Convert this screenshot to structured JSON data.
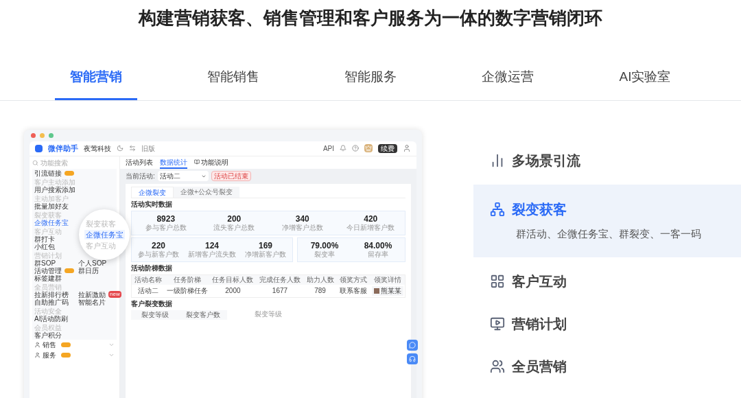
{
  "headline": "构建营销获客、销售管理和客户服务为一体的数字营销闭环",
  "tabs": [
    {
      "label": "智能营销",
      "selected": true
    },
    {
      "label": "智能销售",
      "selected": false
    },
    {
      "label": "智能服务",
      "selected": false
    },
    {
      "label": "企微运营",
      "selected": false
    },
    {
      "label": "AI实验室",
      "selected": false
    }
  ],
  "app": {
    "brand": "微伴助手",
    "company": "夜莺科技",
    "old_version": "旧版",
    "api": "API",
    "renew": "续费",
    "search": {
      "placeholder": "功能搜索"
    },
    "sidebar": {
      "sections": [
        {
          "items": [
            {
              "label": "引流链接",
              "selected": false,
              "badge": {
                "color": "#f5a623"
              }
            }
          ]
        },
        {
          "header": "客户主动添加",
          "items": [
            {
              "label": "用户搜索添加",
              "selected": false
            }
          ]
        },
        {
          "header": "主动加客户",
          "items": [
            {
              "label": "批量加好友",
              "selected": false
            }
          ]
        },
        {
          "header": "裂变获客",
          "items": [
            {
              "label": "企微任务宝",
              "selected": true
            }
          ]
        },
        {
          "header": "客户互动",
          "items": [
            {
              "label": "群打卡",
              "selected": false
            },
            {
              "label": "小红包",
              "selected": false
            }
          ]
        },
        {
          "header": "营销计划",
          "items": [
            {
              "label": "群SOP",
              "selected": false
            },
            {
              "label": "个人SOP",
              "selected": false
            },
            {
              "label": "活动管理",
              "selected": false,
              "badge": {
                "color": "#f5a623"
              }
            },
            {
              "label": "群日历",
              "selected": false
            },
            {
              "label": "标签建群",
              "selected": false
            }
          ]
        },
        {
          "header": "全员营销",
          "items": [
            {
              "label": "拉新排行榜",
              "selected": false
            },
            {
              "label": "拉新激励",
              "selected": false,
              "badge": {
                "text": "new",
                "color": "#e5484d"
              }
            },
            {
              "label": "自助推广码",
              "selected": false
            },
            {
              "label": "智能名片",
              "selected": false
            }
          ]
        },
        {
          "header": "活动安全",
          "items": [
            {
              "label": "AI活动防刷",
              "selected": false
            }
          ]
        },
        {
          "header": "会员权益",
          "items": [
            {
              "label": "客户积分",
              "selected": false
            }
          ]
        }
      ],
      "nav": [
        {
          "label": "销售",
          "expanded": false,
          "badge": {
            "color": "#f5a623"
          }
        },
        {
          "label": "服务",
          "expanded": false,
          "badge": {
            "color": "#f5a623"
          }
        }
      ]
    },
    "magnifier": [
      {
        "label": "裂变获客",
        "selected": false
      },
      {
        "label": "企微任务宝",
        "selected": true
      },
      {
        "label": "客户互动",
        "selected": false
      }
    ],
    "page_tabs": [
      {
        "label": "活动列表",
        "selected": false
      },
      {
        "label": "数据统计",
        "selected": true
      },
      {
        "label": "功能说明",
        "selected": false
      }
    ],
    "filter": {
      "label": "当前活动:",
      "value": "活动二",
      "status": "活动已结束"
    },
    "card_tabs": [
      {
        "label": "企微裂变",
        "selected": true
      },
      {
        "label": "企微+公众号裂变",
        "selected": false
      }
    ],
    "realtime": {
      "title": "活动实时数据",
      "row_1": [
        {
          "value": "8923",
          "label": "参与客户总数"
        },
        {
          "value": "200",
          "label": "流失客户总数"
        },
        {
          "value": "340",
          "label": "净增客户总数"
        },
        {
          "value": "420",
          "label": "今日新增客户数"
        }
      ],
      "row_2a": [
        {
          "value": "220",
          "label": "参与新客户数"
        },
        {
          "value": "124",
          "label": "新增客户流失数"
        },
        {
          "value": "169",
          "label": "净增新客户数"
        }
      ],
      "row_2b": [
        {
          "value": "79.00%",
          "label": "裂变率"
        },
        {
          "value": "84.00%",
          "label": "留存率"
        }
      ]
    },
    "ladder": {
      "title": "活动阶梯数据",
      "columns": [
        "活动名称",
        "任务阶梯",
        "任务目标人数",
        "完成任务人数",
        "助力人数",
        "领奖方式",
        "领奖详情"
      ],
      "rows": [
        [
          "活动二",
          "一级阶梯任务",
          "2000",
          "1677",
          "789",
          "联系客服",
          "熊某某"
        ]
      ]
    },
    "fission": {
      "title": "客户裂变数据",
      "columns": [
        "裂变等级",
        "裂变客户数"
      ],
      "chart_label": "裂变等级"
    }
  },
  "features": [
    {
      "label": "多场景引流",
      "selected": false
    },
    {
      "label": "裂变获客",
      "selected": true,
      "description": "群活动、企微任务宝、群裂变、一客一码"
    },
    {
      "label": "客户互动",
      "selected": false
    },
    {
      "label": "营销计划",
      "selected": false
    },
    {
      "label": "全员营销",
      "selected": false
    }
  ]
}
